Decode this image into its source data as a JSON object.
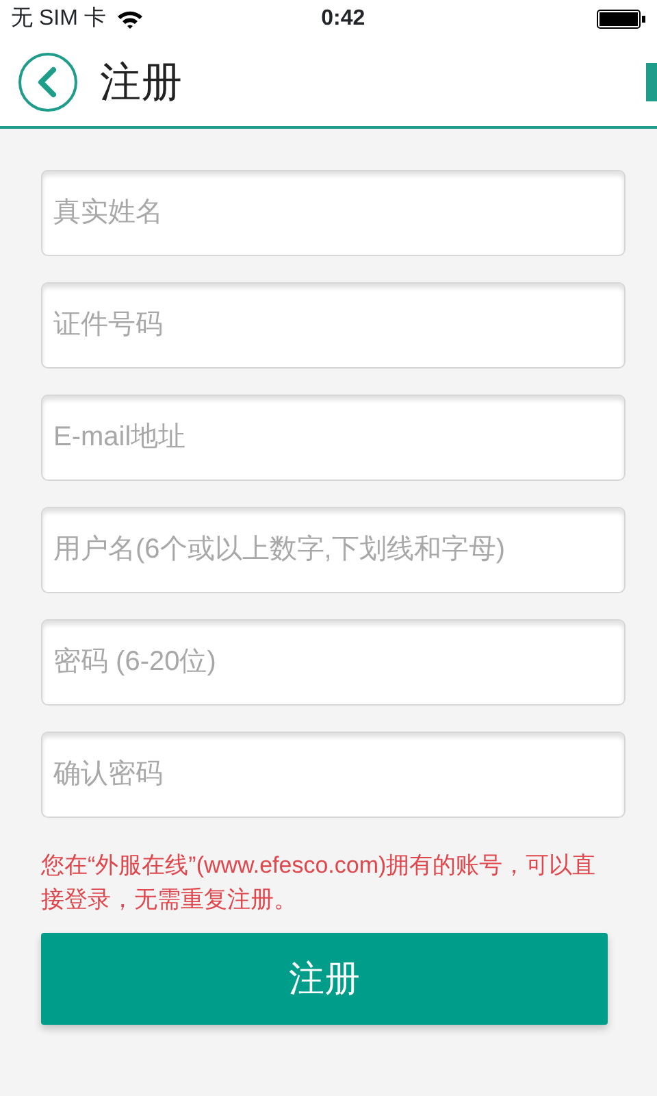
{
  "status_bar": {
    "carrier": "无 SIM 卡",
    "time": "0:42"
  },
  "header": {
    "title": "注册"
  },
  "fields": [
    {
      "placeholder": "真实姓名"
    },
    {
      "placeholder": "证件号码"
    },
    {
      "placeholder": "E-mail地址"
    },
    {
      "placeholder": "用户名(6个或以上数字,下划线和字母)"
    },
    {
      "placeholder": "密码 (6-20位)"
    },
    {
      "placeholder": "确认密码"
    }
  ],
  "notice": "您在“外服在线”(www.efesco.com)拥有的账号，可以直接登录，无需重复注册。",
  "submit_button": "注册"
}
